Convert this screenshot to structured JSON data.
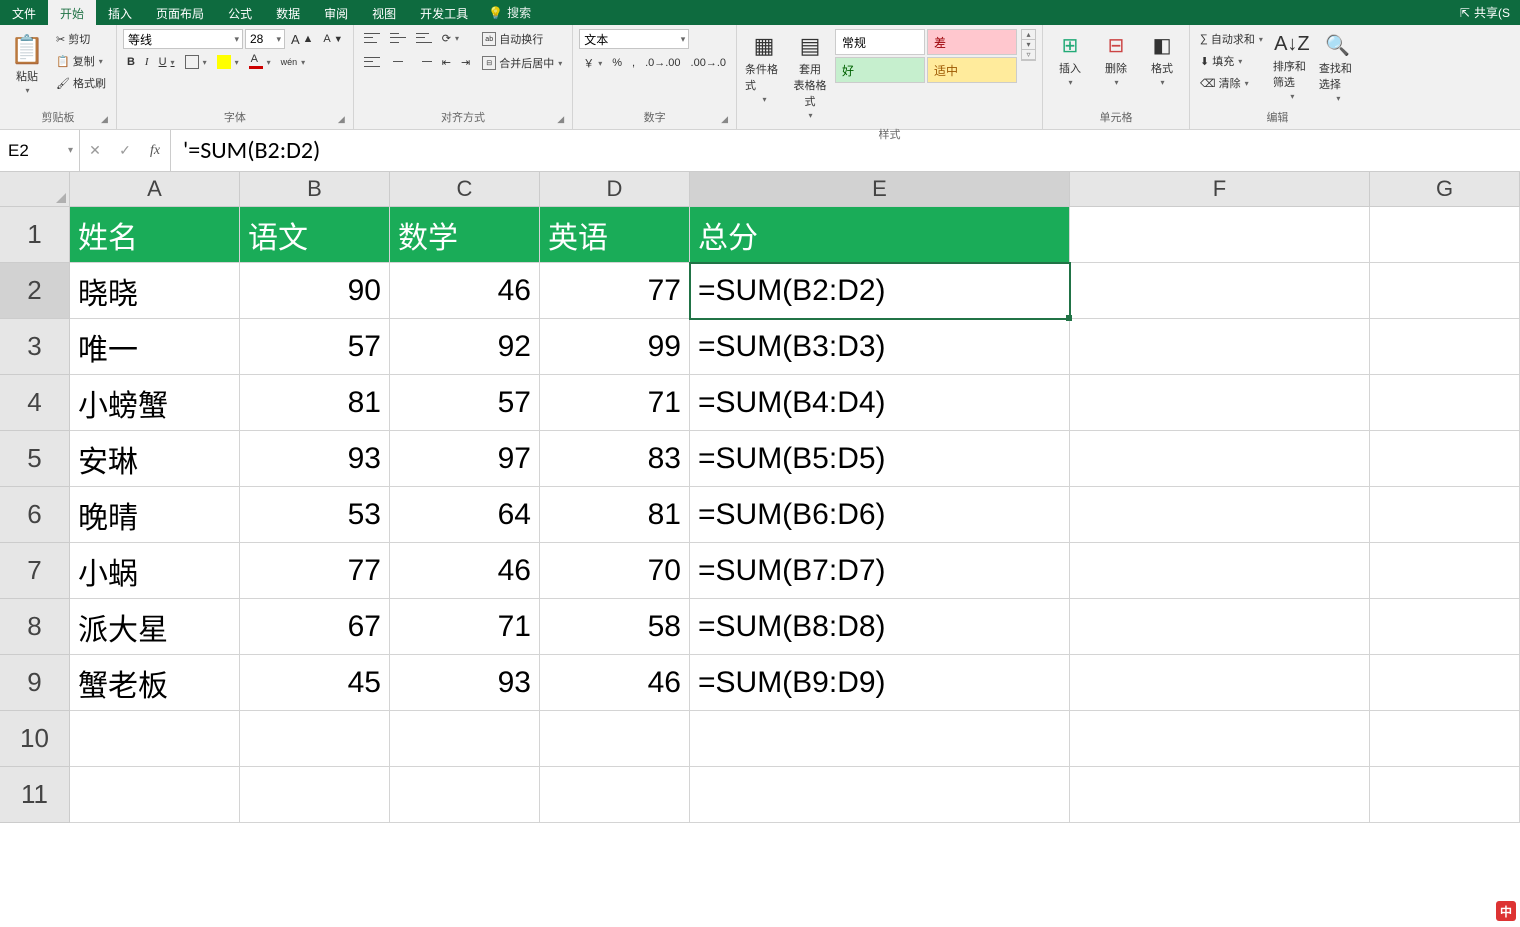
{
  "tabs": {
    "file": "文件",
    "home": "开始",
    "insert": "插入",
    "layout": "页面布局",
    "formulas": "公式",
    "data": "数据",
    "review": "审阅",
    "view": "视图",
    "dev": "开发工具",
    "search": "搜索"
  },
  "share": "共享(S",
  "ribbon": {
    "clipboard": {
      "label": "剪贴板",
      "paste": "粘贴",
      "cut": "剪切",
      "copy": "复制",
      "painter": "格式刷"
    },
    "font": {
      "label": "字体",
      "name": "等线",
      "size": "28",
      "bold": "B",
      "italic": "I",
      "underline": "U",
      "pinyin": "wén"
    },
    "align": {
      "label": "对齐方式",
      "wrap": "自动换行",
      "merge": "合并后居中"
    },
    "number": {
      "label": "数字",
      "format": "文本",
      "currency": "￥"
    },
    "styles": {
      "label": "样式",
      "condfmt": "条件格式",
      "tablefmt": "套用\n表格格式",
      "normal": "常规",
      "bad": "差",
      "good": "好",
      "neutral": "适中"
    },
    "cells": {
      "label": "单元格",
      "insert": "插入",
      "delete": "删除",
      "format": "格式"
    },
    "editing": {
      "label": "编辑",
      "sum": "自动求和",
      "fill": "填充",
      "clear": "清除",
      "sort": "排序和筛选",
      "find": "查找和选择"
    }
  },
  "namebox": "E2",
  "formula": "'=SUM(B2:D2)",
  "columns": [
    "A",
    "B",
    "C",
    "D",
    "E",
    "F",
    "G"
  ],
  "headers": {
    "A": "姓名",
    "B": "语文",
    "C": "数学",
    "D": "英语",
    "E": "总分"
  },
  "rows": [
    {
      "n": 2,
      "A": "晓晓",
      "B": 90,
      "C": 46,
      "D": 77,
      "E": "=SUM(B2:D2)"
    },
    {
      "n": 3,
      "A": "唯一",
      "B": 57,
      "C": 92,
      "D": 99,
      "E": "=SUM(B3:D3)"
    },
    {
      "n": 4,
      "A": "小螃蟹",
      "B": 81,
      "C": 57,
      "D": 71,
      "E": "=SUM(B4:D4)"
    },
    {
      "n": 5,
      "A": "安琳",
      "B": 93,
      "C": 97,
      "D": 83,
      "E": "=SUM(B5:D5)"
    },
    {
      "n": 6,
      "A": "晚晴",
      "B": 53,
      "C": 64,
      "D": 81,
      "E": "=SUM(B6:D6)"
    },
    {
      "n": 7,
      "A": "小蜗",
      "B": 77,
      "C": 46,
      "D": 70,
      "E": "=SUM(B7:D7)"
    },
    {
      "n": 8,
      "A": "派大星",
      "B": 67,
      "C": 71,
      "D": 58,
      "E": "=SUM(B8:D8)"
    },
    {
      "n": 9,
      "A": "蟹老板",
      "B": 45,
      "C": 93,
      "D": 46,
      "E": "=SUM(B9:D9)"
    }
  ],
  "blankRows": [
    10,
    11
  ],
  "activeCell": "E2",
  "ime": "中"
}
